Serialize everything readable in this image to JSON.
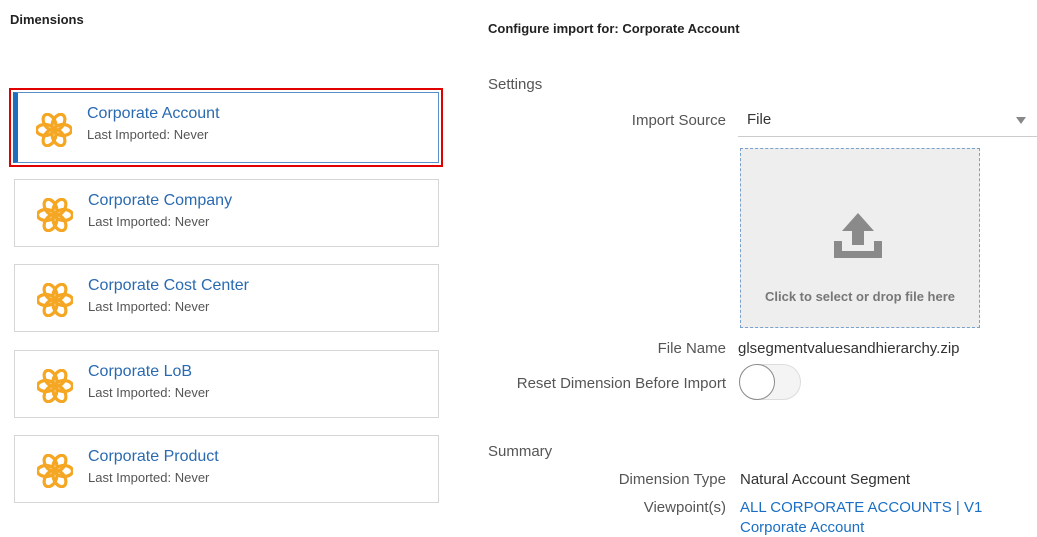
{
  "left": {
    "heading": "Dimensions",
    "cards": [
      {
        "title": "Corporate Account",
        "subtitle": "Last Imported: Never",
        "selected": true
      },
      {
        "title": "Corporate Company",
        "subtitle": "Last Imported: Never",
        "selected": false
      },
      {
        "title": "Corporate Cost Center",
        "subtitle": "Last Imported: Never",
        "selected": false
      },
      {
        "title": "Corporate LoB",
        "subtitle": "Last Imported: Never",
        "selected": false
      },
      {
        "title": "Corporate Product",
        "subtitle": "Last Imported: Never",
        "selected": false
      }
    ],
    "card_icon": "flower-dimension-icon"
  },
  "right": {
    "heading": "Configure import for: Corporate Account",
    "settings": {
      "label": "Settings",
      "import_source_label": "Import Source",
      "import_source_value": "File",
      "dropzone_text": "Click to select or drop file here",
      "dropzone_icon": "upload-icon",
      "file_name_label": "File Name",
      "file_name_value": "glsegmentvaluesandhierarchy.zip",
      "reset_label": "Reset Dimension Before Import",
      "reset_on": false
    },
    "summary": {
      "label": "Summary",
      "dimension_type_label": "Dimension Type",
      "dimension_type_value": "Natural Account Segment",
      "viewpoints_label": "Viewpoint(s)",
      "viewpoints": [
        "ALL CORPORATE ACCOUNTS | V1",
        "Corporate Account"
      ]
    }
  },
  "colors": {
    "accent": "#1e6ec0",
    "link": "#1a6fc4",
    "icon": "#f5a623",
    "highlight": "#e00000"
  }
}
